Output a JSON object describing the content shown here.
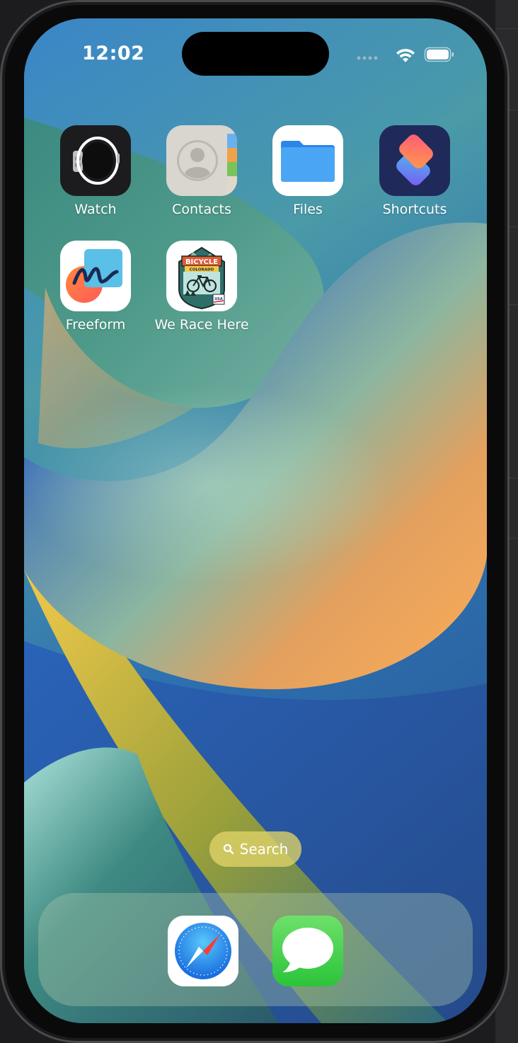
{
  "status_bar": {
    "time": "12:02",
    "icons": [
      "signal-dots-icon",
      "wifi-icon",
      "battery-icon"
    ]
  },
  "home_screen": {
    "apps": [
      {
        "label": "Watch",
        "icon": "watch-icon"
      },
      {
        "label": "Contacts",
        "icon": "contacts-icon"
      },
      {
        "label": "Files",
        "icon": "files-folder-icon"
      },
      {
        "label": "Shortcuts",
        "icon": "shortcuts-icon"
      },
      {
        "label": "Freeform",
        "icon": "freeform-icon"
      },
      {
        "label": "We Race Here",
        "icon": "bicycle-colorado-badge-icon"
      }
    ],
    "we_race_here_badge": {
      "banner_text": "BICYCLE",
      "sub_text": "COLORADO",
      "usa_text": "USA"
    },
    "search_label": "Search"
  },
  "dock": {
    "apps": [
      {
        "name": "Safari",
        "icon": "safari-compass-icon"
      },
      {
        "name": "Messages",
        "icon": "messages-bubble-icon"
      }
    ]
  },
  "colors": {
    "wallpaper_blue": "#3f86c4",
    "wallpaper_orange": "#e8a060",
    "wallpaper_yellow": "#f4d24a",
    "accent_green_messages": "#4cd964"
  }
}
